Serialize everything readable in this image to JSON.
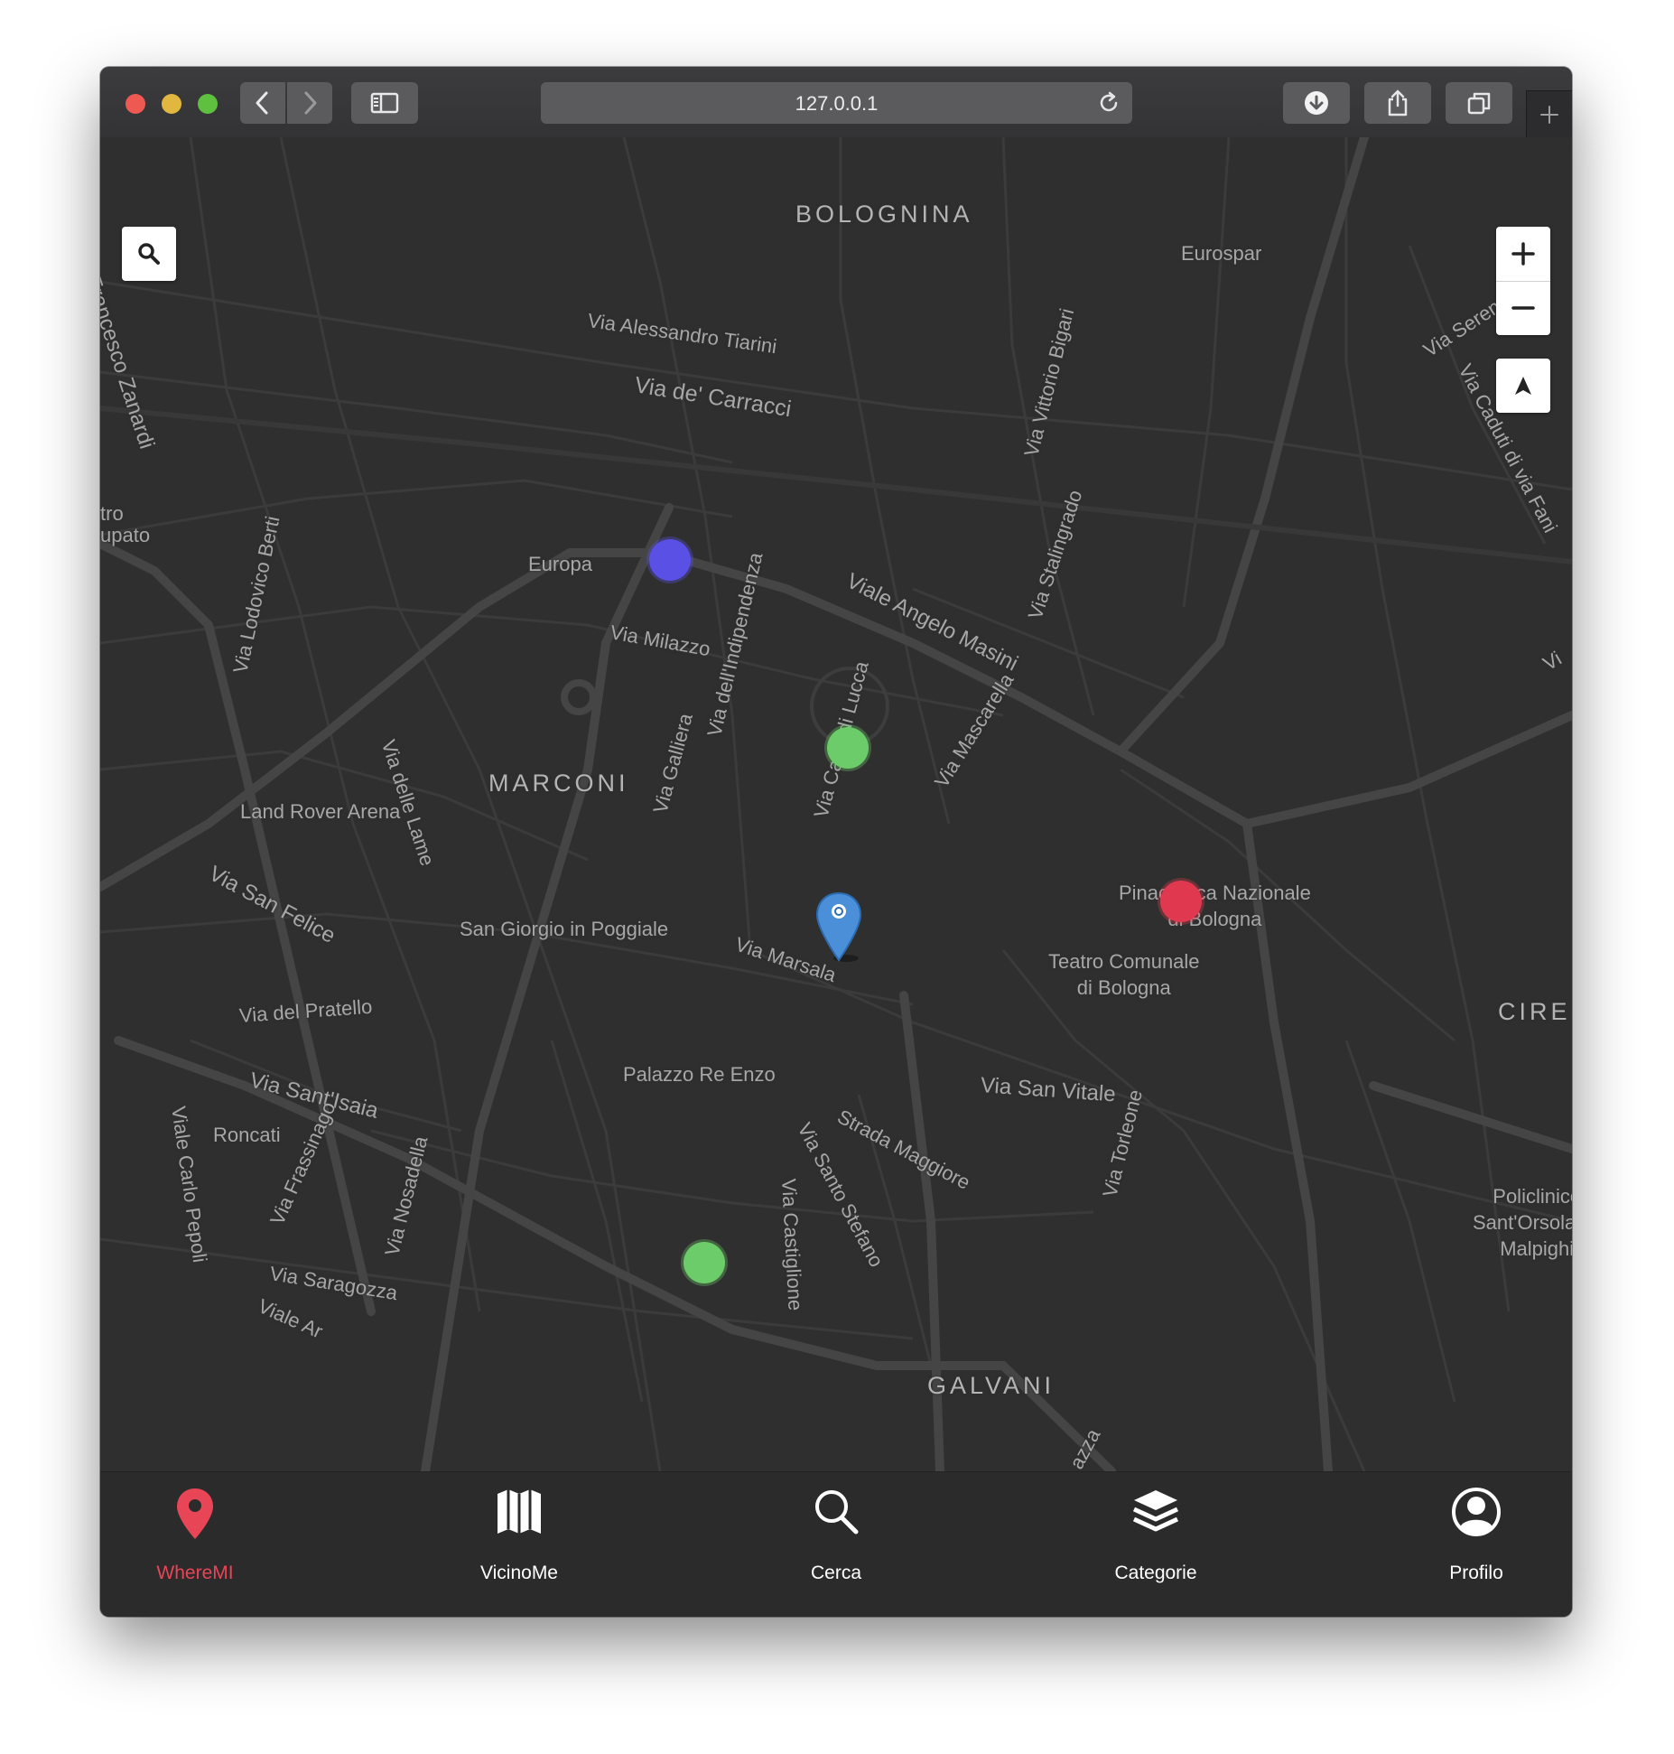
{
  "browser": {
    "url": "127.0.0.1",
    "icons": [
      "back-icon",
      "forward-icon",
      "sidebar-icon",
      "reload-icon",
      "download-icon",
      "share-icon",
      "tabs-icon",
      "new-tab-icon"
    ]
  },
  "map": {
    "districts": [
      "BOLOGNINA",
      "MARCONI",
      "GALVANI",
      "CIRE"
    ],
    "streets": [
      "Via Alessandro Tiarini",
      "Via de' Carracci",
      "Via Vittorio Bigari",
      "Eurospar",
      "Via Serena",
      "Via Caduti di via Fani",
      "Francesco Zanardi",
      "Europa",
      "Viale Angelo Masini",
      "Via Milazzo",
      "Via dell'Indipendenza",
      "Via Stalingrado",
      "Via Lodovico Berti",
      "Via delle Lame",
      "Via Galliera",
      "Via Capo di Lucca",
      "Via Mascarella",
      "Via San Felice",
      "Via Marsala",
      "Via del Pratello",
      "Via Sant'Isaia",
      "Roncati",
      "Via Frassinago",
      "Via Nosadella",
      "Strada Maggiore",
      "Via Santo Stefano",
      "Via Castiglione",
      "Via San Vitale",
      "Via Torleone",
      "Via Saragozza",
      "Viale Carlo Pepoli",
      "Viale Ar",
      "Vi",
      "tro",
      "upato",
      "azza"
    ],
    "pois": [
      "Land Rover Arena",
      "San Giorgio in Poggiale",
      "Palazzo Re Enzo",
      "Pinacoteca Nazionale\ndi Bologna",
      "Teatro Comunale\ndi Bologna",
      "Policlinico\nSant'Orsola —\nMalpighi"
    ],
    "marker_colors": [
      "#5b50e6",
      "#6dcc6a",
      "#e0394f",
      "#6dcc6a"
    ],
    "user_pin_color": "#4a8fd8",
    "controls": {
      "search_icon": "search-icon",
      "zoom_in": "+",
      "zoom_out": "−",
      "compass_icon": "navigation-arrow-icon"
    }
  },
  "tabbar": {
    "accent": "#e84557",
    "tabs": [
      {
        "label": "WhereMI",
        "icon": "map-pin-icon",
        "active": true
      },
      {
        "label": "VicinoMe",
        "icon": "map-icon",
        "active": false
      },
      {
        "label": "Cerca",
        "icon": "search-icon",
        "active": false
      },
      {
        "label": "Categorie",
        "icon": "layers-icon",
        "active": false
      },
      {
        "label": "Profilo",
        "icon": "user-circle-icon",
        "active": false
      }
    ]
  }
}
